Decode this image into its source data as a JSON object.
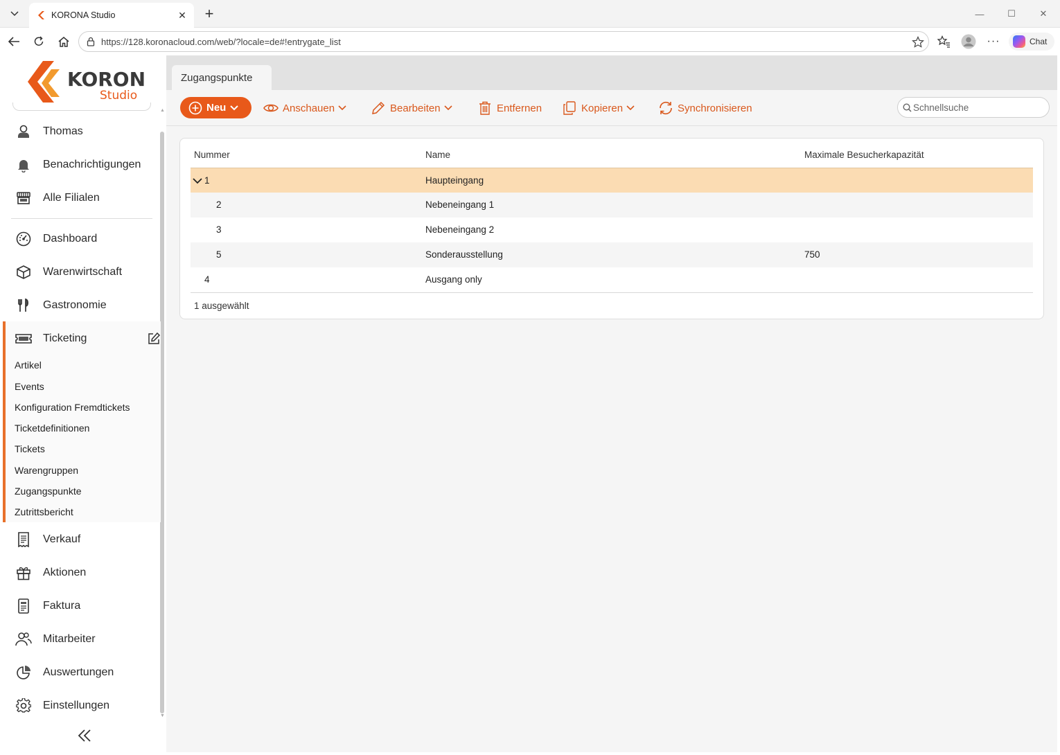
{
  "browser": {
    "tab_title": "KORONA Studio",
    "url": "https://128.koronacloud.com/web/?locale=de#!entrygate_list",
    "chat_label": "Chat"
  },
  "logo": {
    "brand": "KORONA",
    "product": "Studio"
  },
  "sidebar": {
    "top_items": [
      {
        "label": "Thomas",
        "icon": "user-icon"
      },
      {
        "label": "Benachrichtigungen",
        "icon": "bell-icon"
      },
      {
        "label": "Alle Filialen",
        "icon": "store-icon"
      }
    ],
    "items": [
      {
        "label": "Dashboard",
        "icon": "dashboard-icon"
      },
      {
        "label": "Warenwirtschaft",
        "icon": "box-icon"
      },
      {
        "label": "Gastronomie",
        "icon": "cutlery-icon"
      }
    ],
    "active_section": {
      "label": "Ticketing",
      "icon": "ticket-icon",
      "subitems": [
        "Artikel",
        "Events",
        "Konfiguration Fremdtickets",
        "Ticketdefinitionen",
        "Tickets",
        "Warengruppen",
        "Zugangspunkte",
        "Zutrittsbericht"
      ]
    },
    "bottom_items": [
      {
        "label": "Verkauf",
        "icon": "receipt-icon"
      },
      {
        "label": "Aktionen",
        "icon": "gift-icon"
      },
      {
        "label": "Faktura",
        "icon": "invoice-icon"
      },
      {
        "label": "Mitarbeiter",
        "icon": "users-icon"
      },
      {
        "label": "Auswertungen",
        "icon": "pie-chart-icon"
      },
      {
        "label": "Einstellungen",
        "icon": "gear-icon"
      }
    ]
  },
  "main": {
    "tab_label": "Zugangspunkte",
    "toolbar": {
      "new_label": "Neu",
      "view_label": "Anschauen",
      "edit_label": "Bearbeiten",
      "delete_label": "Entfernen",
      "copy_label": "Kopieren",
      "sync_label": "Synchronisieren",
      "search_placeholder": "Schnellsuche"
    },
    "grid": {
      "columns": [
        "Nummer",
        "Name",
        "Maximale Besucherkapazität"
      ],
      "rows": [
        {
          "number": "1",
          "name": "Haupteingang",
          "capacity": ""
        },
        {
          "number": "2",
          "name": "Nebeneingang 1",
          "capacity": ""
        },
        {
          "number": "3",
          "name": "Nebeneingang 2",
          "capacity": ""
        },
        {
          "number": "5",
          "name": "Sonderausstellung",
          "capacity": "750"
        },
        {
          "number": "4",
          "name": "Ausgang only",
          "capacity": ""
        }
      ],
      "footer": "1 ausgewählt"
    }
  },
  "colors": {
    "accent": "#e8591a",
    "selection": "#fbdcb3",
    "sidebar_marker": "#e8702a"
  }
}
